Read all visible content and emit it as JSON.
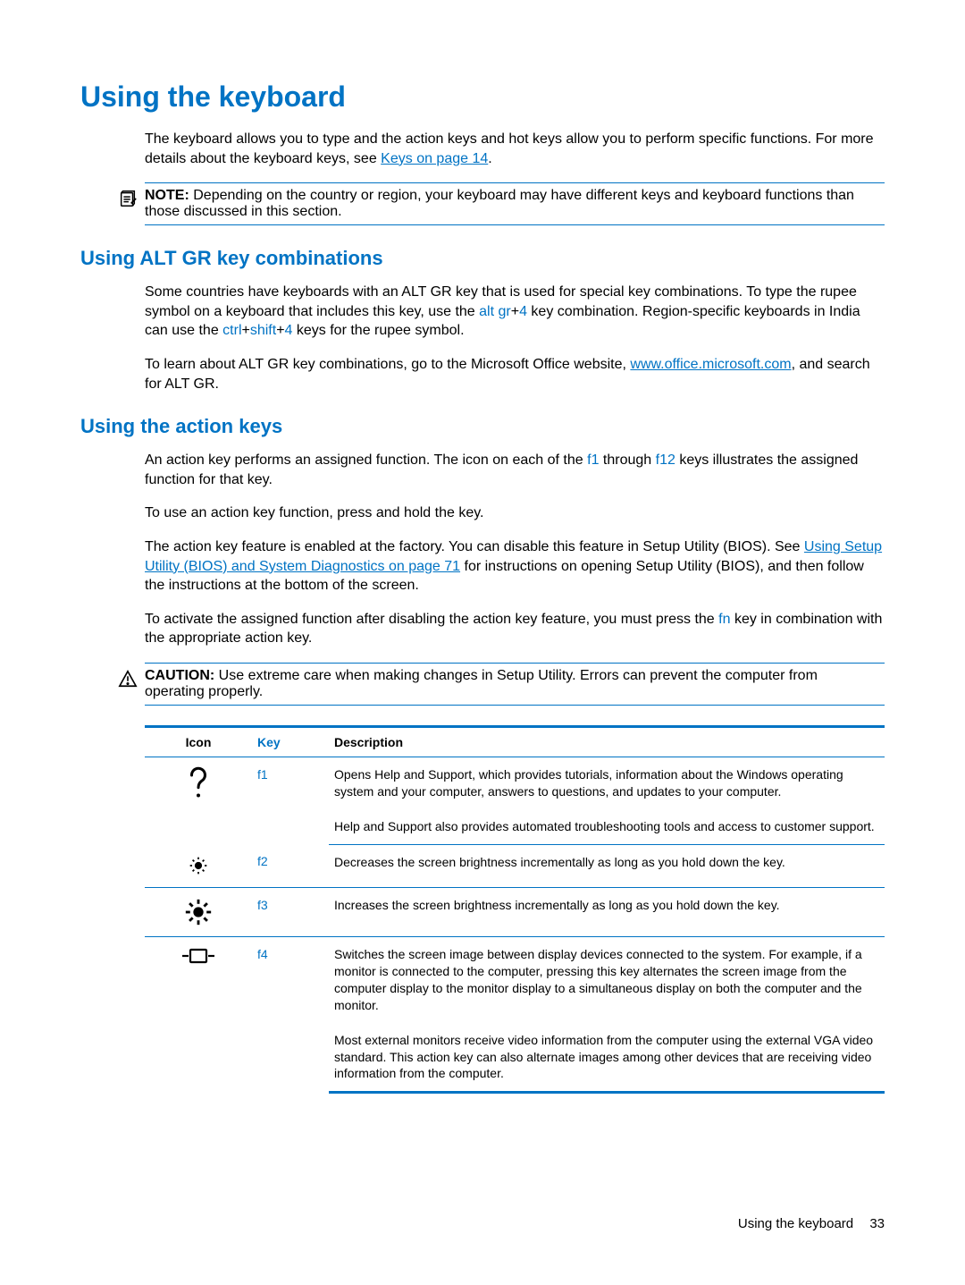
{
  "heading_main": "Using the keyboard",
  "intro_text_before_link": "The keyboard allows you to type and the action keys and hot keys allow you to perform specific functions. For more details about the keyboard keys, see ",
  "intro_link": "Keys on page 14",
  "intro_text_after_link": ".",
  "note": {
    "label": "NOTE:",
    "text": "Depending on the country or region, your keyboard may have different keys and keyboard functions than those discussed in this section."
  },
  "section_altgr": {
    "heading": "Using ALT GR key combinations",
    "para1_parts": {
      "p1": "Some countries have keyboards with an ALT GR key that is used for special key combinations. To type the rupee symbol on a keyboard that includes this key, use the ",
      "k1": "alt gr",
      "plus1": "+",
      "k2": "4",
      "p2": " key combination. Region-specific keyboards in India can use the ",
      "k3": "ctrl",
      "plus2": "+",
      "k4": "shift",
      "plus3": "+",
      "k5": "4",
      "p3": " keys for the rupee symbol."
    },
    "para2_before": "To learn about ALT GR key combinations, go to the Microsoft Office website, ",
    "para2_link": "www.office.microsoft.com",
    "para2_after": ", and search for ALT GR."
  },
  "section_action": {
    "heading": "Using the action keys",
    "para1_before": "An action key performs an assigned function. The icon on each of the ",
    "key_f1": "f1",
    "para1_mid": " through ",
    "key_f12": "f12",
    "para1_after": " keys illustrates the assigned function for that key.",
    "para2": "To use an action key function, press and hold the key.",
    "para3_before": "The action key feature is enabled at the factory. You can disable this feature in Setup Utility (BIOS). See ",
    "para3_link": "Using Setup Utility (BIOS) and System Diagnostics on page 71",
    "para3_after": " for instructions on opening Setup Utility (BIOS), and then follow the instructions at the bottom of the screen.",
    "para4_before": "To activate the assigned function after disabling the action key feature, you must press the ",
    "key_fn": "fn",
    "para4_after": " key in combination with the appropriate action key."
  },
  "caution": {
    "label": "CAUTION:",
    "text": "Use extreme care when making changes in Setup Utility. Errors can prevent the computer from operating properly."
  },
  "table": {
    "headers": {
      "icon": "Icon",
      "key": "Key",
      "desc": "Description"
    },
    "rows": {
      "r1": {
        "key": "f1",
        "desc1": "Opens Help and Support, which provides tutorials, information about the Windows operating system and your computer, answers to questions, and updates to your computer.",
        "desc2": "Help and Support also provides automated troubleshooting tools and access to customer support."
      },
      "r2": {
        "key": "f2",
        "desc": "Decreases the screen brightness incrementally as long as you hold down the key."
      },
      "r3": {
        "key": "f3",
        "desc": "Increases the screen brightness incrementally as long as you hold down the key."
      },
      "r4": {
        "key": "f4",
        "desc1": "Switches the screen image between display devices connected to the system. For example, if a monitor is connected to the computer, pressing this key alternates the screen image from the computer display to the monitor display to a simultaneous display on both the computer and the monitor.",
        "desc2": "Most external monitors receive video information from the computer using the external VGA video standard. This action key can also alternate images among other devices that are receiving video information from the computer."
      }
    }
  },
  "footer": {
    "title": "Using the keyboard",
    "page": "33"
  }
}
